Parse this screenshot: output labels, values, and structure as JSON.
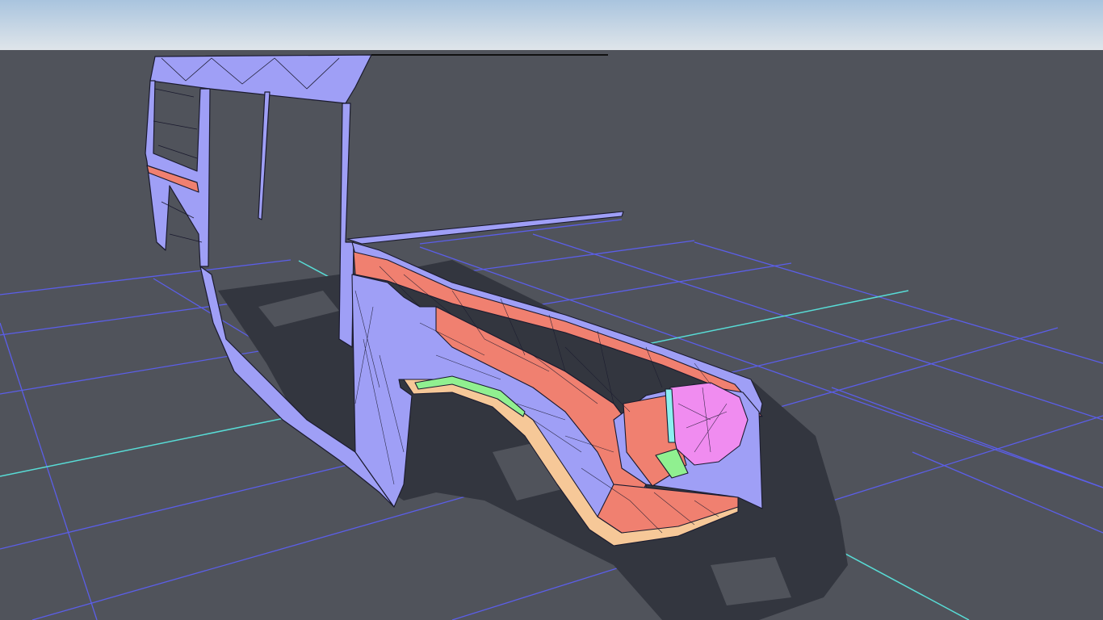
{
  "viewport": {
    "sky_color_top": "#a9c4de",
    "sky_color_bottom": "#dde4ea",
    "ground_color": "#50535b",
    "grid_color": "#5b5ee8",
    "axis_color": "#58dcd6",
    "shadow_color": "#33363f"
  },
  "model": {
    "mesh_color": "#9f9ff6",
    "edge_color": "#1a1a2e",
    "group_colors": {
      "orange": "#f08070",
      "pink": "#f08cf0",
      "green": "#90f090",
      "cyan": "#8cf0f0",
      "peach": "#f6c898"
    }
  }
}
